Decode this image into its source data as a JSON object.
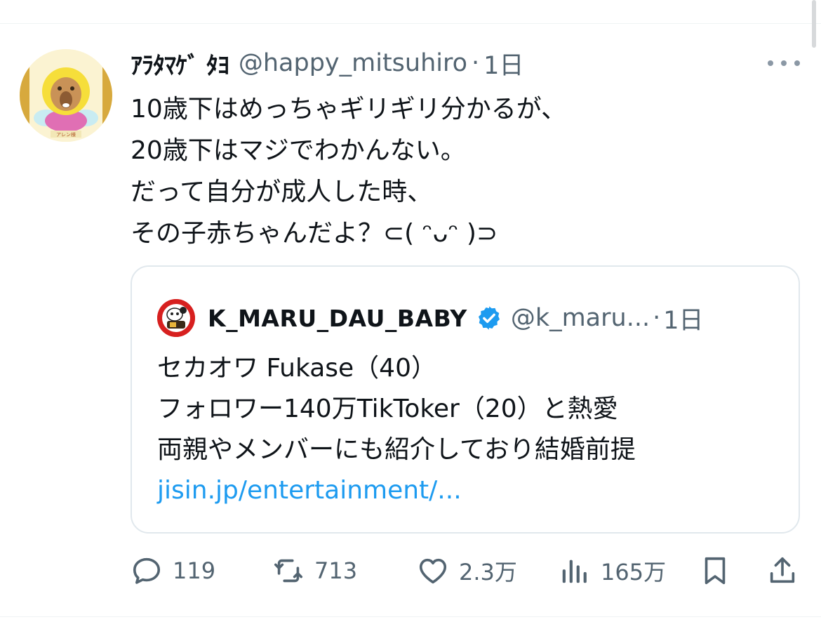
{
  "tweet": {
    "display_name": "ｱﾗﾀﾏｹﾞ ﾀﾖ",
    "handle": "@happy_mitsuhiro",
    "separator": "·",
    "time": "1日",
    "text_lines": [
      "10歳下はめっちゃギリギリ分かるが、",
      "20歳下はマジでわかんない。",
      "だって自分が成人した時、",
      "その子赤ちゃんだよ？⊂( ᵔᴗᵔ )⊃"
    ],
    "avatar_caption": "アレン様"
  },
  "quote": {
    "display_name": "K_MARU_DAU_BABY",
    "verified": true,
    "handle": "@k_maru...",
    "separator": "·",
    "time": "1日",
    "lines": [
      "セカオワ Fukase（40）",
      "フォロワー140万TikToker（20）と熱愛",
      "両親やメンバーにも紹介しており結婚前提"
    ],
    "link": "jisin.jp/entertainment/..."
  },
  "actions": {
    "replies": "119",
    "retweets": "713",
    "likes": "2.3万",
    "views": "165万"
  },
  "colors": {
    "text": "#0f1419",
    "secondary": "#536471",
    "link": "#1d9bf0",
    "verified": "#1d9bf0",
    "border": "#e1e8ed"
  },
  "icons": [
    "more-icon",
    "verified-badge-icon",
    "reply-icon",
    "retweet-icon",
    "like-icon",
    "views-icon",
    "bookmark-icon",
    "share-icon"
  ]
}
